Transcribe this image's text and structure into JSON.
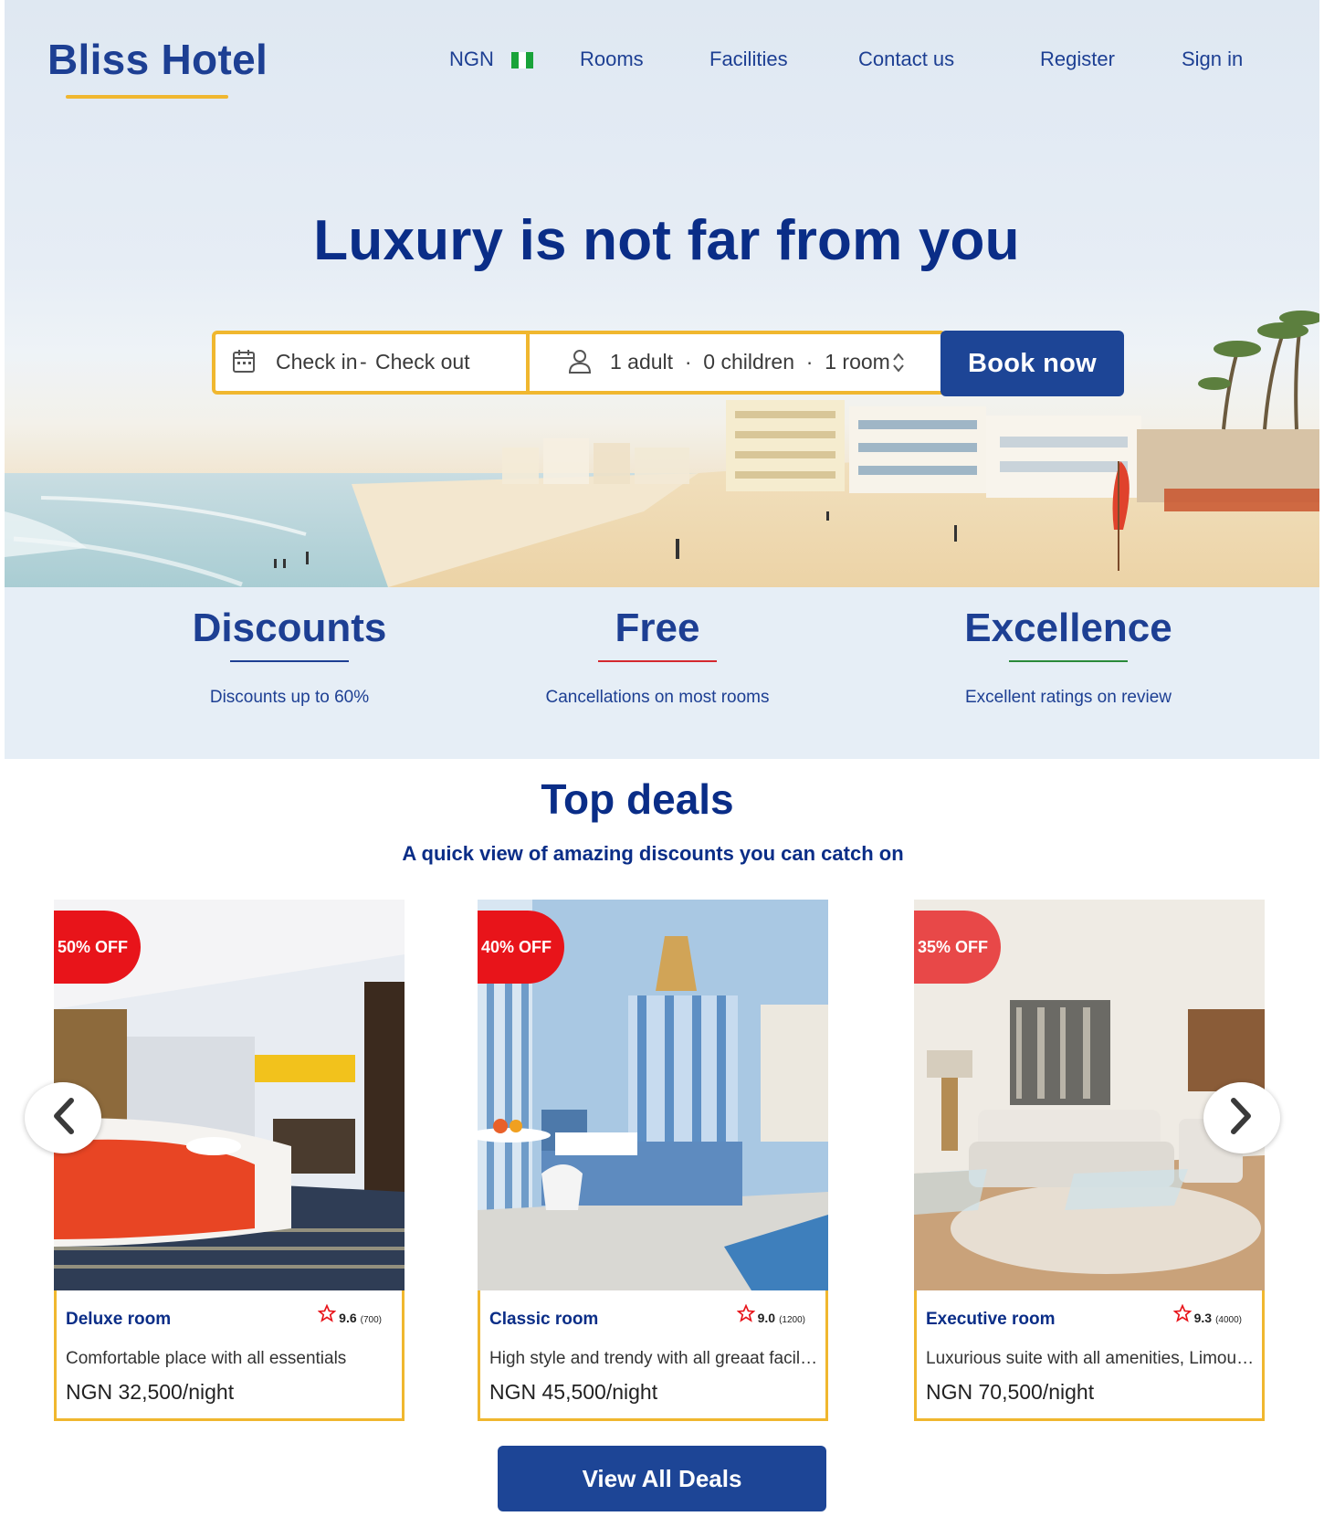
{
  "header": {
    "brand": "Bliss Hotel",
    "nav": {
      "currency": "NGN",
      "rooms": "Rooms",
      "facilities": "Facilities",
      "contact": "Contact us",
      "register": "Register",
      "signin": "Sign in"
    },
    "flag_colors": [
      "#19a339",
      "#ffffff",
      "#19a339"
    ]
  },
  "hero": {
    "headline": "Luxury is not far from you",
    "search": {
      "checkin": "Check in",
      "separator": "-",
      "checkout": "Check out",
      "guests": "1 adult  ·  0 children  ·  1 room"
    },
    "book_button": "Book now",
    "icons": [
      "calendar-icon",
      "person-icon",
      "sort-icon"
    ]
  },
  "features": [
    {
      "title": "Discounts",
      "subtitle": "Discounts up to 60%",
      "accent": "#1d3f93"
    },
    {
      "title": "Free",
      "subtitle": "Cancellations on most rooms",
      "accent": "#d4282e"
    },
    {
      "title": "Excellence",
      "subtitle": "Excellent ratings on review",
      "accent": "#2a8a3a"
    }
  ],
  "deals": {
    "title": "Top deals",
    "subtitle": "A quick view of amazing discounts you can catch on",
    "cards": [
      {
        "badge": "50% OFF",
        "name": "Deluxe room",
        "score": "9.6",
        "count": "(700)",
        "description": "Comfortable place with all essentials",
        "price": "NGN 32,500/night"
      },
      {
        "badge": "40% OFF",
        "name": "Classic room",
        "score": "9.0",
        "count": "(1200)",
        "description": "High style and trendy with all greaat facilities",
        "price": "NGN 45,500/night"
      },
      {
        "badge": "35% OFF",
        "name": "Executive room",
        "score": "9.3",
        "count": "(4000)",
        "description": "Luxurious suite with all amenities, Limousine service",
        "price": "NGN 70,500/night"
      }
    ],
    "view_all": "View All Deals"
  },
  "colors": {
    "brand_blue": "#1d4596",
    "accent_yellow": "#f0b72f",
    "badge_red": "#e8141a"
  }
}
